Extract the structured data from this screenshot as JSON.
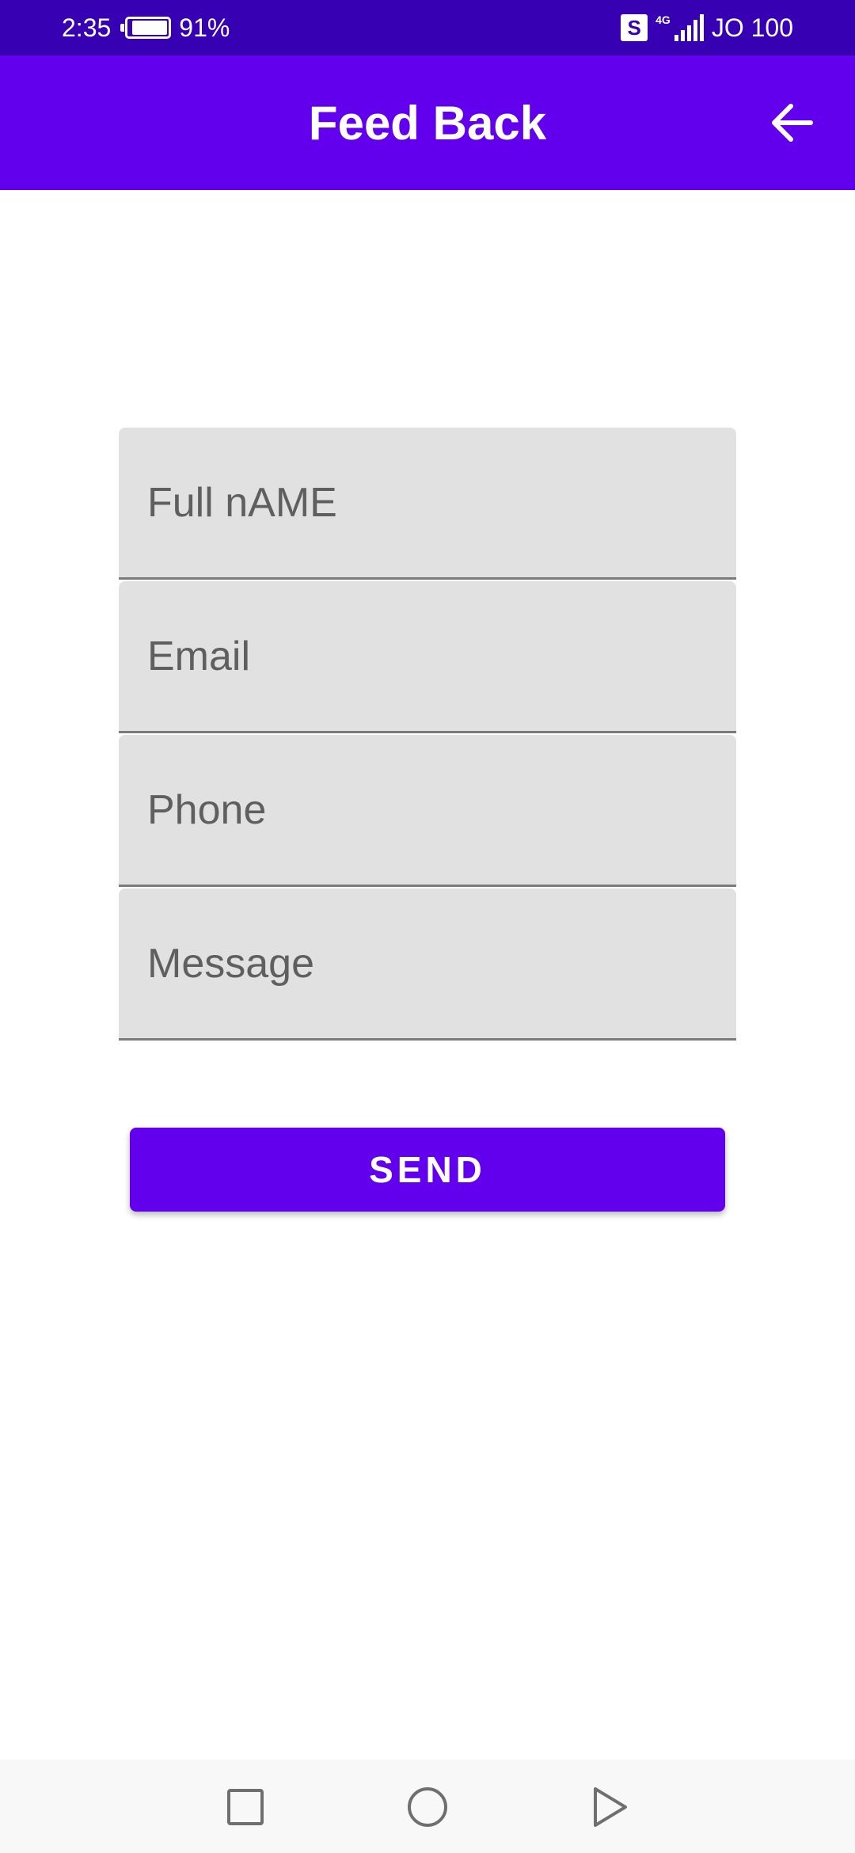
{
  "status_bar": {
    "time": "2:35",
    "battery_percent": "91%",
    "battery_level": 0.91,
    "sim_badge": "S",
    "network_type": "4G",
    "carrier": "JO 100"
  },
  "app_bar": {
    "title": "Feed Back",
    "back_icon": "arrow-left-icon"
  },
  "form": {
    "fields": [
      {
        "placeholder": "Full nAME",
        "value": ""
      },
      {
        "placeholder": "Email",
        "value": ""
      },
      {
        "placeholder": "Phone",
        "value": ""
      },
      {
        "placeholder": "Message",
        "value": ""
      }
    ],
    "send_label": "SEND"
  },
  "nav_bar": {
    "recents_icon": "square-icon",
    "home_icon": "circle-icon",
    "back_icon": "triangle-back-icon"
  },
  "colors": {
    "status_bar": "#3700b3",
    "primary": "#6200ee",
    "field_background": "#e1e1e1",
    "field_underline": "#7b7b7b",
    "placeholder_text": "#5f5f5f"
  }
}
